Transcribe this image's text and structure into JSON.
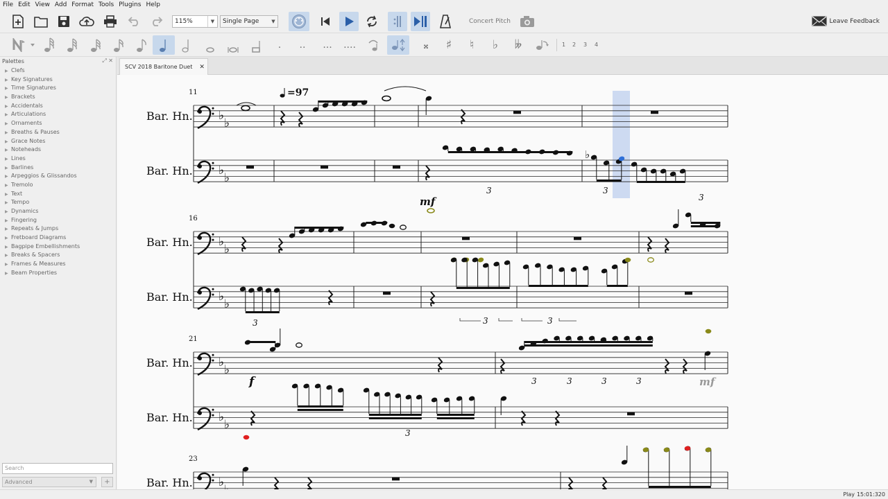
{
  "menu": [
    "File",
    "Edit",
    "View",
    "Add",
    "Format",
    "Tools",
    "Plugins",
    "Help"
  ],
  "toolbar": {
    "zoom_value": "115%",
    "view_mode": "Single Page",
    "concert_pitch_label": "Concert Pitch",
    "feedback_label": "Leave Feedback"
  },
  "note_input": {
    "voices": [
      "1",
      "2",
      "3",
      "4"
    ],
    "dots": [
      ".",
      "..",
      "...",
      "...."
    ],
    "accidentals": [
      "𝄪",
      "♯",
      "♮",
      "♭",
      "𝄫"
    ]
  },
  "palettes": {
    "title": "Palettes",
    "items": [
      "Clefs",
      "Key Signatures",
      "Time Signatures",
      "Brackets",
      "Accidentals",
      "Articulations",
      "Ornaments",
      "Breaths & Pauses",
      "Grace Notes",
      "Noteheads",
      "Lines",
      "Barlines",
      "Arpeggios & Glissandos",
      "Tremolo",
      "Text",
      "Tempo",
      "Dynamics",
      "Fingering",
      "Repeats & Jumps",
      "Fretboard Diagrams",
      "Bagpipe Embellishments",
      "Breaks & Spacers",
      "Frames & Measures",
      "Beam Properties"
    ],
    "search_placeholder": "Search",
    "mode": "Advanced",
    "add_label": "+"
  },
  "tab": {
    "title": "SCV 2018 Baritone Duet",
    "close": "✕"
  },
  "score": {
    "instrument": "Bar. Hn.",
    "tempo": "=97",
    "systems": [
      {
        "measure_number": "11"
      },
      {
        "measure_number": "16"
      },
      {
        "measure_number": "21"
      },
      {
        "measure_number": "23"
      }
    ],
    "dynamics": [
      "mf",
      "f",
      "mf"
    ],
    "tuplet": "3",
    "colors": {
      "selection": "#c8d6f0",
      "selected_note": "#2e6fd8",
      "out_of_range_warn": "#8a8a1a",
      "out_of_range_bad": "#e02020"
    }
  },
  "status": {
    "mode": "Play",
    "time": "15:01:320"
  }
}
